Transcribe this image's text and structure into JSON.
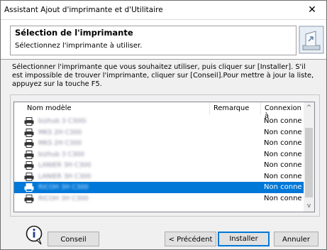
{
  "window": {
    "title": "Assistant Ajout d'imprimante et d'Utilitaire",
    "close_glyph": "✕"
  },
  "header": {
    "title": "Sélection de l'imprimante",
    "subtitle": "Sélectionnez l'imprimante à utiliser."
  },
  "instructions": "Sélectionner l'imprimante que vous souhaitez utiliser, puis cliquer sur [Installer]. S'il est impossible de trouver l'imprimante, cliquer sur [Conseil].Pour mettre à jour la liste, appuyez sur la touche F5.",
  "list": {
    "columns": {
      "model": "Nom modèle",
      "remark": "Remarque",
      "connection": "Connexion à"
    },
    "rows": [
      {
        "model": "bizhub 3 C300i",
        "remark": "",
        "connection": "Non conne",
        "selected": false
      },
      {
        "model": "MKS 2H C300",
        "remark": "",
        "connection": "Non conne",
        "selected": false
      },
      {
        "model": "MKS 2H C300",
        "remark": "",
        "connection": "Non conne",
        "selected": false
      },
      {
        "model": "bizhub 3 C300",
        "remark": "",
        "connection": "Non conne",
        "selected": false
      },
      {
        "model": "LANIER 3H C300",
        "remark": "",
        "connection": "Non conne",
        "selected": false
      },
      {
        "model": "LANIER 3H C300",
        "remark": "",
        "connection": "Non conne",
        "selected": false
      },
      {
        "model": "RICOH 3H C300",
        "remark": "",
        "connection": "Non conne",
        "selected": true
      },
      {
        "model": "RICOH 3H C300",
        "remark": "",
        "connection": "Non conne",
        "selected": false
      }
    ],
    "scroll_up_glyph": "^",
    "scroll_down_glyph": "v"
  },
  "buttons": {
    "conseil": "Conseil",
    "precedent": "< Précédent",
    "installer": "Installer",
    "annuler": "Annuler"
  },
  "icons": {
    "info": "info-icon",
    "printer": "printer-icon",
    "header": "printer-setup-icon"
  },
  "colors": {
    "selection": "#0078d7",
    "default_button_border": "#0078d7"
  }
}
